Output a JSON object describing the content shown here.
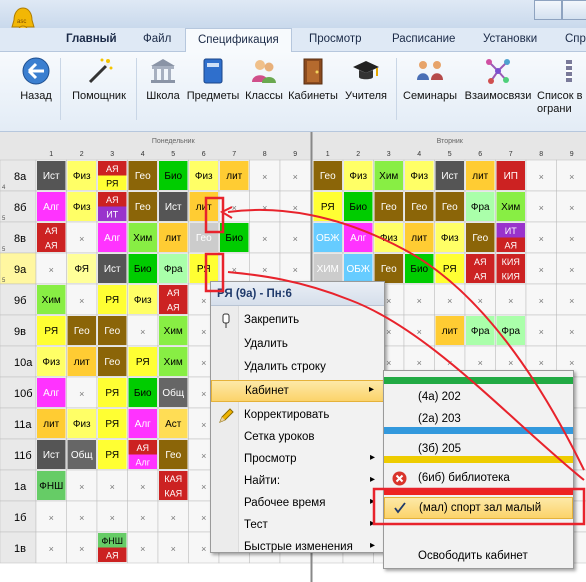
{
  "ribbon_tabs": [
    "Главный",
    "Файл",
    "Спецификация",
    "Просмотр",
    "Расписание",
    "Установки",
    "Спр"
  ],
  "active_tab": "Спецификация",
  "toolbar": [
    {
      "label": "Назад",
      "icon": "back-arrow-icon"
    },
    {
      "label": "Помощник",
      "icon": "magic-wand-icon"
    },
    {
      "label": "Школа",
      "icon": "school-building-icon"
    },
    {
      "label": "Предметы",
      "icon": "book-icon"
    },
    {
      "label": "Классы",
      "icon": "students-icon"
    },
    {
      "label": "Кабинеты",
      "icon": "door-icon"
    },
    {
      "label": "Учителя",
      "icon": "graduation-cap-icon"
    },
    {
      "label": "Семинары",
      "icon": "seminar-icon"
    },
    {
      "label": "Взаимосвязи",
      "icon": "relations-icon"
    },
    {
      "label": "Список в",
      "label2": "ограни",
      "icon": "list-icon"
    }
  ],
  "days": [
    "Понедельник",
    "Вторник"
  ],
  "periods": [
    "1",
    "2",
    "3",
    "4",
    "5",
    "6",
    "7",
    "8",
    "9"
  ],
  "colors": {
    "Ист": "#555555",
    "Физ": "#ffff66",
    "АЯ": "#cc2222",
    "РЯ": "#ffff33",
    "Гео": "#8b6508",
    "Био": "#00cc00",
    "лит": "#ffcc33",
    "Алг": "#ff33ff",
    "Хим": "#88ee44",
    "ИТ": "#9933cc",
    "Фра": "#aaffaa",
    "ФЯ": "#ffff99",
    "ОБЖ": "#66ccff",
    "КИЯ": "#cc2222",
    "ИП": "#cc2222",
    "Общ": "#666666",
    "Аст": "#ffdd55",
    "ФНШ": "#66cc66",
    "КАЯ": "#cc2222"
  },
  "classes": [
    {
      "name": "8а",
      "sub": "4",
      "lessons": [
        [
          "Ист"
        ],
        [
          "Физ"
        ],
        [
          "АЯ",
          "РЯ"
        ],
        [
          "Гео"
        ],
        [
          "Био"
        ],
        [
          "Физ"
        ],
        [
          "лит"
        ],
        [
          "x"
        ],
        [
          "x"
        ],
        [
          "Гео"
        ],
        [
          "Физ"
        ],
        [
          "Хим"
        ],
        [
          "Физ"
        ],
        [
          "Ист"
        ],
        [
          "лит"
        ],
        [
          "ИП"
        ],
        [
          "x"
        ],
        [
          "x"
        ]
      ]
    },
    {
      "name": "8б",
      "sub": "5",
      "lessons": [
        [
          "Алг"
        ],
        [
          "Физ"
        ],
        [
          "АЯ",
          "ИТ"
        ],
        [
          "Гео"
        ],
        [
          "Ист"
        ],
        [
          "лит"
        ],
        [
          "x"
        ],
        [
          "x"
        ],
        [
          "x"
        ],
        [
          "РЯ"
        ],
        [
          "Био"
        ],
        [
          "Гео"
        ],
        [
          "Гео"
        ],
        [
          "Гео"
        ],
        [
          "Фра"
        ],
        [
          "Хим"
        ],
        [
          "x"
        ],
        [
          "x"
        ]
      ]
    },
    {
      "name": "8в",
      "sub": "5",
      "lessons": [
        [
          "АЯ",
          "АЯ"
        ],
        [
          "x"
        ],
        [
          "Алг"
        ],
        [
          "Хим"
        ],
        [
          "лит"
        ],
        [
          "Геo"
        ],
        [
          "Био"
        ],
        [
          "x"
        ],
        [
          "x"
        ],
        [
          "ОБЖ"
        ],
        [
          "Алг"
        ],
        [
          "Физ"
        ],
        [
          "лит"
        ],
        [
          "Физ"
        ],
        [
          "Гео"
        ],
        [
          "ИТ",
          "АЯ"
        ],
        [
          "x"
        ],
        [
          "x"
        ]
      ]
    },
    {
      "name": "9а",
      "sub": "5",
      "lessons": [
        [
          "x"
        ],
        [
          "ФЯ"
        ],
        [
          "Ист"
        ],
        [
          "Био"
        ],
        [
          "Фра"
        ],
        [
          "РЯ"
        ],
        [
          "x"
        ],
        [
          "x"
        ],
        [
          "x"
        ],
        [
          "ХИМ"
        ],
        [
          "ОБЖ"
        ],
        [
          "Гео"
        ],
        [
          "Био"
        ],
        [
          "РЯ"
        ],
        [
          "АЯ",
          "АЯ"
        ],
        [
          "КИЯ",
          "КИЯ"
        ],
        [
          "x"
        ],
        [
          "x"
        ]
      ]
    },
    {
      "name": "9б",
      "sub": "",
      "lessons": [
        [
          "Хим"
        ],
        [
          "x"
        ],
        [
          "РЯ"
        ],
        [
          "Физ"
        ],
        [
          "АЯ",
          "АЯ"
        ],
        [
          "x"
        ],
        [
          "x"
        ],
        [
          "x"
        ],
        [
          "x"
        ],
        [
          "x"
        ],
        [
          "x"
        ],
        [
          "x"
        ],
        [
          "x"
        ],
        [
          "x"
        ],
        [
          "x"
        ],
        [
          "x"
        ],
        [
          "x"
        ],
        [
          "x"
        ]
      ]
    },
    {
      "name": "9в",
      "sub": "",
      "lessons": [
        [
          "РЯ"
        ],
        [
          "Гео"
        ],
        [
          "Гео"
        ],
        [
          "x"
        ],
        [
          "Хим"
        ],
        [
          "x"
        ],
        [
          "x"
        ],
        [
          "x"
        ],
        [
          "x"
        ],
        [
          "x"
        ],
        [
          "x"
        ],
        [
          "x"
        ],
        [
          "x"
        ],
        [
          "лит"
        ],
        [
          "Фра"
        ],
        [
          "Фра"
        ],
        [
          "x"
        ],
        [
          "x"
        ]
      ]
    },
    {
      "name": "10а",
      "sub": "",
      "lessons": [
        [
          "Физ"
        ],
        [
          "лит"
        ],
        [
          "Гео"
        ],
        [
          "РЯ"
        ],
        [
          "Хим"
        ],
        [
          "x"
        ],
        [
          "x"
        ],
        [
          "x"
        ],
        [
          "x"
        ],
        [
          "x"
        ],
        [
          "x"
        ],
        [
          "x"
        ],
        [
          "x"
        ],
        [
          "x"
        ],
        [
          "x"
        ],
        [
          "x"
        ],
        [
          "x"
        ],
        [
          "x"
        ]
      ]
    },
    {
      "name": "10б",
      "sub": "",
      "lessons": [
        [
          "Алг"
        ],
        [
          "x"
        ],
        [
          "РЯ"
        ],
        [
          "Био"
        ],
        [
          "Общ"
        ],
        [
          "x"
        ],
        [
          "x"
        ],
        [
          "x"
        ],
        [
          "x"
        ],
        [
          "x"
        ],
        [
          "x"
        ],
        [
          "x"
        ],
        [
          "x"
        ],
        [
          "x"
        ],
        [
          "x"
        ],
        [
          "x"
        ],
        [
          "x"
        ],
        [
          "x"
        ]
      ]
    },
    {
      "name": "11а",
      "sub": "",
      "lessons": [
        [
          "лит"
        ],
        [
          "Физ"
        ],
        [
          "РЯ"
        ],
        [
          "Алг"
        ],
        [
          "Аст"
        ],
        [
          "x"
        ],
        [
          "x"
        ],
        [
          "x"
        ],
        [
          "x"
        ],
        [
          "x"
        ],
        [
          "x"
        ],
        [
          "x"
        ],
        [
          "x"
        ],
        [
          "x"
        ],
        [
          "x"
        ],
        [
          "x"
        ],
        [
          "x"
        ],
        [
          "x"
        ]
      ]
    },
    {
      "name": "11б",
      "sub": "",
      "lessons": [
        [
          "Ист"
        ],
        [
          "Общ"
        ],
        [
          "РЯ"
        ],
        [
          "АЯ",
          "Алг"
        ],
        [
          "Гео"
        ],
        [
          "x"
        ],
        [
          "x"
        ],
        [
          "x"
        ],
        [
          "x"
        ],
        [
          "x"
        ],
        [
          "x"
        ],
        [
          "x"
        ],
        [
          "x"
        ],
        [
          "x"
        ],
        [
          "x"
        ],
        [
          "x"
        ],
        [
          "x"
        ],
        [
          "x"
        ]
      ]
    },
    {
      "name": "1а",
      "sub": "",
      "lessons": [
        [
          "ФНШ"
        ],
        [
          "x"
        ],
        [
          "x"
        ],
        [
          "x"
        ],
        [
          "КАЯ",
          "КАЯ"
        ],
        [
          "x"
        ],
        [
          "x"
        ],
        [
          "x"
        ],
        [
          "x"
        ],
        [
          "x"
        ],
        [
          "x"
        ],
        [
          "x"
        ],
        [
          "x"
        ],
        [
          "x"
        ],
        [
          "x"
        ],
        [
          "x"
        ],
        [
          "x"
        ],
        [
          "x"
        ]
      ]
    },
    {
      "name": "1б",
      "sub": "",
      "lessons": [
        [
          "x"
        ],
        [
          "x"
        ],
        [
          "x"
        ],
        [
          "x"
        ],
        [
          "x"
        ],
        [
          "x"
        ],
        [
          "x"
        ],
        [
          "x"
        ],
        [
          "x"
        ],
        [
          "x"
        ],
        [
          "x"
        ],
        [
          "x"
        ],
        [
          "x"
        ],
        [
          "x"
        ],
        [
          "x"
        ],
        [
          "x"
        ],
        [
          "x"
        ],
        [
          "x"
        ]
      ]
    },
    {
      "name": "1в",
      "sub": "",
      "lessons": [
        [
          "x"
        ],
        [
          "x"
        ],
        [
          "ФНШ",
          "АЯ"
        ],
        [
          "x"
        ],
        [
          "x"
        ],
        [
          "x"
        ],
        [
          "x"
        ],
        [
          "x"
        ],
        [
          "x"
        ],
        [
          "x"
        ],
        [
          "x"
        ],
        [
          "x"
        ],
        [
          "x"
        ],
        [
          "x"
        ],
        [
          "x"
        ],
        [
          "x"
        ],
        [
          "x"
        ],
        [
          "x"
        ]
      ]
    }
  ],
  "context_menu": {
    "title": "РЯ (9а) - Пн:6",
    "items": [
      {
        "label": "Закрепить",
        "icon": "pin-icon",
        "arrow": false
      },
      {
        "label": "Удалить",
        "icon": "",
        "arrow": false
      },
      {
        "label": "Удалить строку",
        "icon": "",
        "arrow": false
      },
      {
        "label": "Кабинет",
        "icon": "",
        "arrow": true,
        "highlight": true
      },
      {
        "label": "Корректировать",
        "icon": "pencil-icon",
        "arrow": false
      },
      {
        "label": "Сетка уроков",
        "icon": "",
        "arrow": false
      },
      {
        "label": "Просмотр",
        "icon": "",
        "arrow": true
      },
      {
        "label": "Найти:",
        "icon": "",
        "arrow": true
      },
      {
        "label": "Рабочее время",
        "icon": "",
        "arrow": true
      },
      {
        "label": "Тест",
        "icon": "",
        "arrow": true
      },
      {
        "label": "Быстрые изменения",
        "icon": "",
        "arrow": true
      }
    ]
  },
  "room_submenu": {
    "items": [
      {
        "label": "(4а) 202",
        "bar": "#22aa44"
      },
      {
        "label": "(2а) 203",
        "bar": ""
      },
      {
        "label": "(3б) 205",
        "bar": "#3399dd"
      },
      {
        "label": "(6иб) библиотека",
        "bar": "#eecc00",
        "icon": "no-entry-icon"
      },
      {
        "label": "(мал) спорт зал малый",
        "bar": "#ee2222",
        "checked": true
      },
      {
        "label": "Освободить кабинет",
        "bar": ""
      }
    ]
  }
}
